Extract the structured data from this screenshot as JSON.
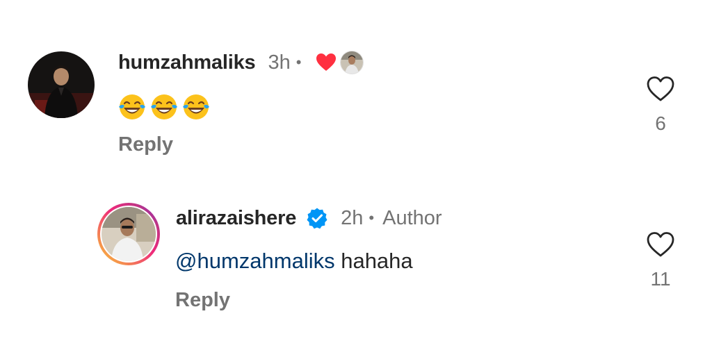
{
  "comments": [
    {
      "username": "humzahmaliks",
      "time": "3h",
      "separator": "•",
      "text": "😂😂😂",
      "emoji": [
        "face-with-tears-of-joy",
        "face-with-tears-of-joy",
        "face-with-tears-of-joy"
      ],
      "reply_label": "Reply",
      "like_count": "6",
      "liked_by_author": true,
      "colors": {
        "liked_heart": "#ff3040"
      }
    },
    {
      "username": "alirazaishere",
      "verified": true,
      "time": "2h",
      "separator": "•",
      "badge": "Author",
      "mention": "@humzahmaliks",
      "text": " hahaha",
      "reply_label": "Reply",
      "like_count": "11",
      "colors": {
        "verified": "#0095f6",
        "mention": "#00376b",
        "story_ring": [
          "#f9ce34",
          "#ee2a7b",
          "#6228d7"
        ]
      }
    }
  ]
}
